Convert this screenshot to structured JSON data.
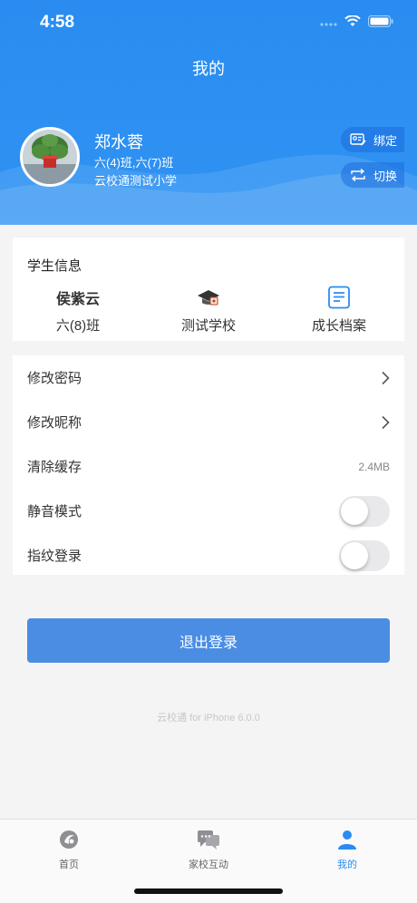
{
  "status_bar": {
    "time": "4:58"
  },
  "header": {
    "title": "我的",
    "user_name": "郑水蓉",
    "user_classes": "六(4)班,六(7)班",
    "user_school": "云校通测试小学",
    "bind_label": "绑定",
    "switch_label": "切换"
  },
  "student_info": {
    "title": "学生信息",
    "student_name": "侯紫云",
    "student_class": "六(8)班",
    "school_label": "测试学校",
    "archive_label": "成长档案"
  },
  "settings": {
    "change_password": "修改密码",
    "change_nickname": "修改昵称",
    "clear_cache": "清除缓存",
    "cache_size": "2.4MB",
    "mute_mode": "静音模式",
    "mute_on": false,
    "fingerprint_login": "指纹登录",
    "fingerprint_on": false
  },
  "logout_label": "退出登录",
  "version_text": "云校通 for iPhone 6.0.0",
  "tabbar": {
    "home": "首页",
    "interaction": "家校互动",
    "mine": "我的",
    "active": "mine"
  },
  "colors": {
    "brand": "#2a8cf0",
    "button": "#4a8de3"
  }
}
